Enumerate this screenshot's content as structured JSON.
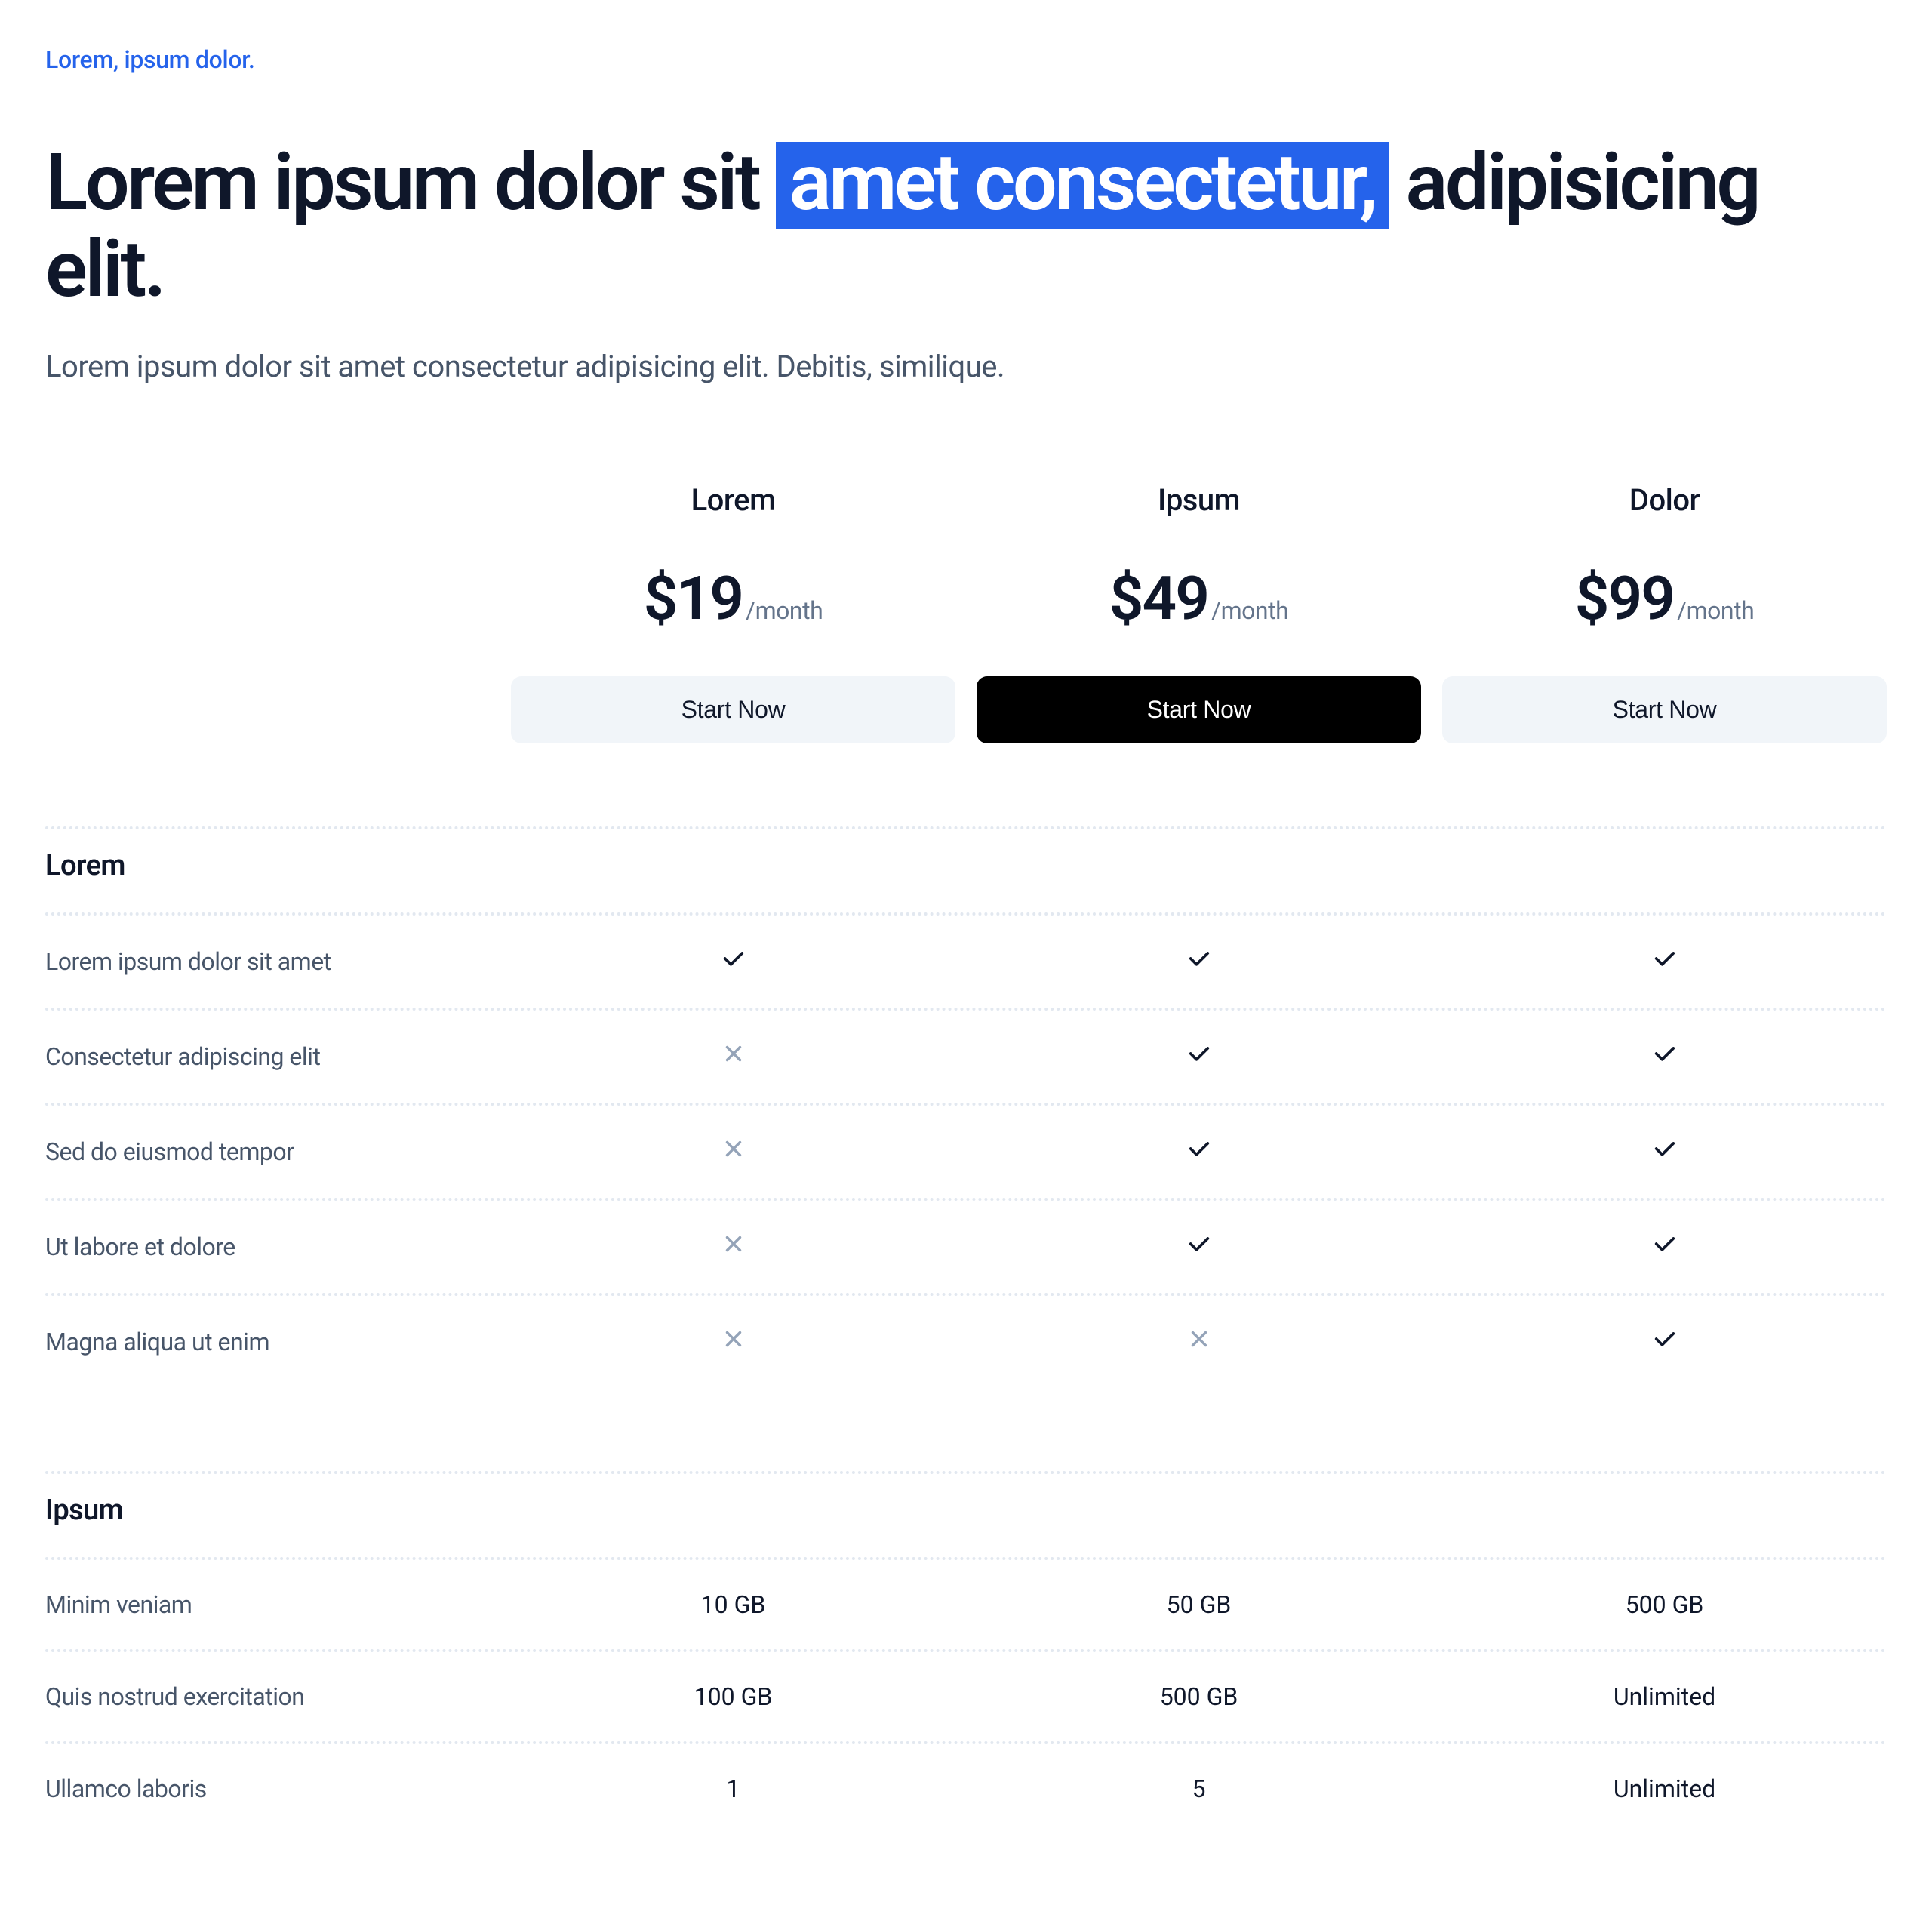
{
  "eyebrow": "Lorem, ipsum dolor.",
  "hero": {
    "title_pre": "Lorem ipsum dolor sit ",
    "title_highlight": "amet consectetur,",
    "title_post": " adipisicing elit.",
    "subtitle": "Lorem ipsum dolor sit amet consectetur adipisicing elit. Debitis, similique."
  },
  "plans": [
    {
      "name": "Lorem",
      "price": "$19",
      "period": "/month",
      "cta": "Start Now",
      "variant": "secondary"
    },
    {
      "name": "Ipsum",
      "price": "$49",
      "period": "/month",
      "cta": "Start Now",
      "variant": "primary"
    },
    {
      "name": "Dolor",
      "price": "$99",
      "period": "/month",
      "cta": "Start Now",
      "variant": "secondary"
    }
  ],
  "sections": [
    {
      "title": "Lorem",
      "rows": [
        {
          "label": "Lorem ipsum dolor sit amet",
          "cells": [
            {
              "type": "check"
            },
            {
              "type": "check"
            },
            {
              "type": "check"
            }
          ]
        },
        {
          "label": "Consectetur adipiscing elit",
          "cells": [
            {
              "type": "x"
            },
            {
              "type": "check"
            },
            {
              "type": "check"
            }
          ]
        },
        {
          "label": "Sed do eiusmod tempor",
          "cells": [
            {
              "type": "x"
            },
            {
              "type": "check"
            },
            {
              "type": "check"
            }
          ]
        },
        {
          "label": "Ut labore et dolore",
          "cells": [
            {
              "type": "x"
            },
            {
              "type": "check"
            },
            {
              "type": "check"
            }
          ]
        },
        {
          "label": "Magna aliqua ut enim",
          "cells": [
            {
              "type": "x"
            },
            {
              "type": "x"
            },
            {
              "type": "check"
            }
          ]
        }
      ]
    },
    {
      "title": "Ipsum",
      "rows": [
        {
          "label": "Minim veniam",
          "cells": [
            {
              "type": "text",
              "value": "10 GB"
            },
            {
              "type": "text",
              "value": "50 GB"
            },
            {
              "type": "text",
              "value": "500 GB"
            }
          ]
        },
        {
          "label": "Quis nostrud exercitation",
          "cells": [
            {
              "type": "text",
              "value": "100 GB"
            },
            {
              "type": "text",
              "value": "500 GB"
            },
            {
              "type": "text",
              "value": "Unlimited"
            }
          ]
        },
        {
          "label": "Ullamco laboris",
          "cells": [
            {
              "type": "text",
              "value": "1"
            },
            {
              "type": "text",
              "value": "5"
            },
            {
              "type": "text",
              "value": "Unlimited"
            }
          ]
        }
      ]
    }
  ]
}
